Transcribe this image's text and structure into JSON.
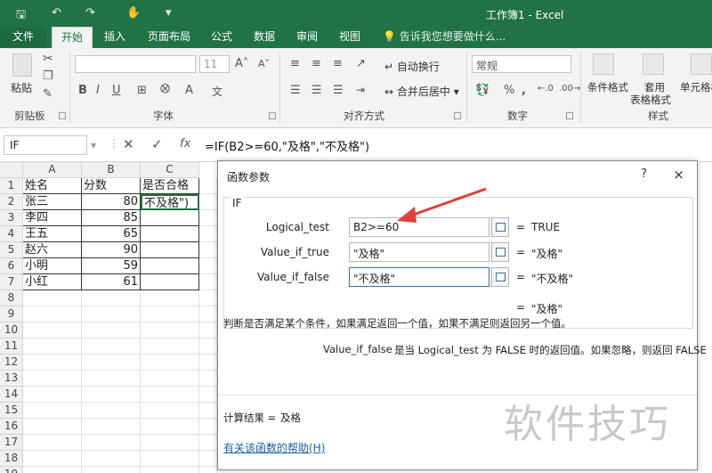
{
  "window": {
    "title": "工作簿1 - Excel"
  },
  "quick_access": {
    "save_icon": "save-icon",
    "undo_icon": "undo-icon",
    "redo_icon": "redo-icon",
    "touch_icon": "touch-mode-icon",
    "customize_icon": "customize-icon"
  },
  "tabs": [
    {
      "label": "文件"
    },
    {
      "label": "开始"
    },
    {
      "label": "插入"
    },
    {
      "label": "页面布局"
    },
    {
      "label": "公式"
    },
    {
      "label": "数据"
    },
    {
      "label": "审阅"
    },
    {
      "label": "视图"
    }
  ],
  "tell_me": "告诉我您想要做什么...",
  "ribbon": {
    "clipboard": {
      "label": "剪贴板",
      "paste": "粘贴"
    },
    "font": {
      "label": "字体",
      "size": "11"
    },
    "alignment": {
      "label": "对齐方式",
      "wrap": "自动换行",
      "merge": "合并后居中"
    },
    "number": {
      "label": "数字",
      "format": "常规"
    },
    "styles": {
      "label": "样式",
      "conditional": "条件格式",
      "table1": "套用",
      "table2": "表格格式",
      "cell": "单元格样"
    }
  },
  "formula_bar": {
    "name_box": "IF",
    "formula": "=IF(B2>=60,\"及格\",\"不及格\")"
  },
  "columns": [
    "A",
    "B",
    "C"
  ],
  "rows": [
    "1",
    "2",
    "3",
    "4",
    "5",
    "6",
    "7",
    "8",
    "9",
    "10",
    "11",
    "12",
    "13",
    "14",
    "15",
    "16",
    "17",
    "18",
    "19"
  ],
  "table": {
    "headers": [
      "姓名",
      "分数",
      "是否合格"
    ],
    "data": [
      [
        "张三",
        "80",
        "不及格\")"
      ],
      [
        "李四",
        "85",
        ""
      ],
      [
        "王五",
        "65",
        ""
      ],
      [
        "赵六",
        "90",
        ""
      ],
      [
        "小明",
        "59",
        ""
      ],
      [
        "小红",
        "61",
        ""
      ]
    ]
  },
  "dialog": {
    "title": "函数参数",
    "help": "?",
    "close": "×",
    "function_name": "IF",
    "args": [
      {
        "label": "Logical_test",
        "value": "B2>=60",
        "result": "TRUE"
      },
      {
        "label": "Value_if_true",
        "value": "\"及格\"",
        "result": "\"及格\""
      },
      {
        "label": "Value_if_false",
        "value": "\"不及格\"",
        "result": "\"不及格\""
      }
    ],
    "overall_result": "\"及格\"",
    "description": "判断是否满足某个条件，如果满足返回一个值，如果不满足则返回另一个值。",
    "arg_name": "Value_if_false",
    "arg_desc": "是当 Logical_test 为 FALSE 时的返回值。如果忽略，则返回 FALSE",
    "calc_label": "计算结果 =",
    "calc_value": "及格",
    "help_link": "有关该函数的帮助(H)"
  },
  "watermark": "软件技巧",
  "colors": {
    "excel_green": "#217346",
    "arrow_red": "#e0403a",
    "link_blue": "#1b5fa8"
  }
}
